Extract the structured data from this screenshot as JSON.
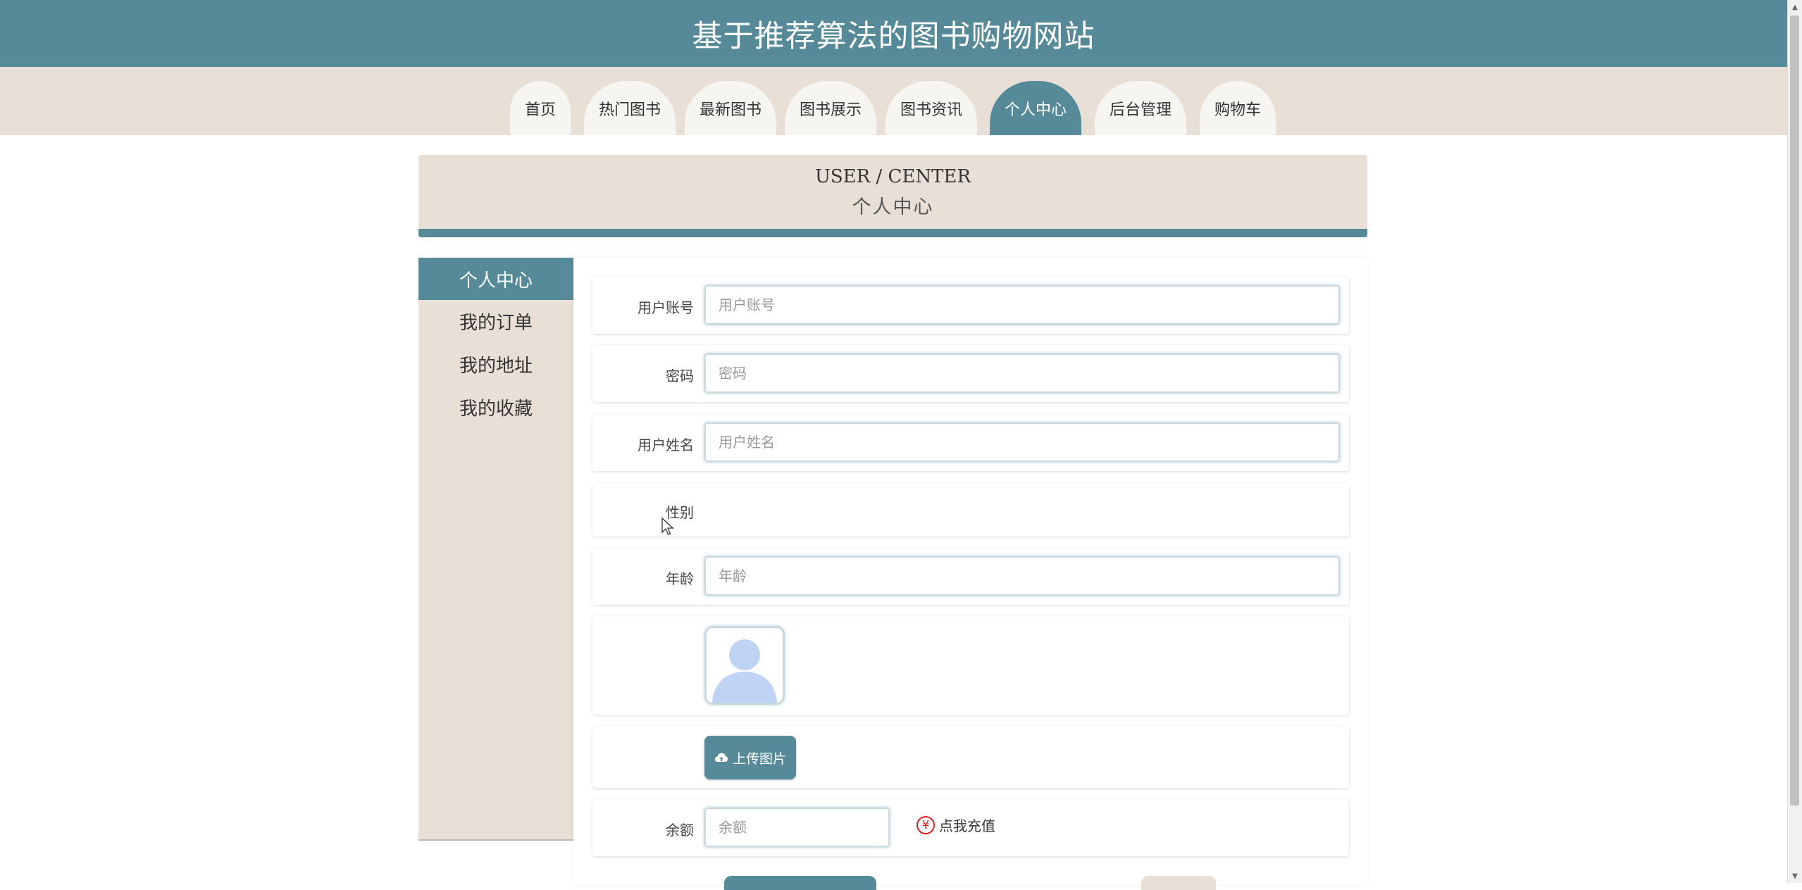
{
  "header": {
    "title": "基于推荐算法的图书购物网站"
  },
  "nav": {
    "tabs": [
      {
        "label": "首页"
      },
      {
        "label": "热门图书"
      },
      {
        "label": "最新图书"
      },
      {
        "label": "图书展示"
      },
      {
        "label": "图书资讯"
      },
      {
        "label": "个人中心",
        "active": true
      },
      {
        "label": "后台管理"
      },
      {
        "label": "购物车"
      }
    ]
  },
  "banner": {
    "en": "USER / CENTER",
    "cn": "个人中心"
  },
  "sidebar": {
    "items": [
      {
        "label": "个人中心",
        "active": true
      },
      {
        "label": "我的订单"
      },
      {
        "label": "我的地址"
      },
      {
        "label": "我的收藏"
      }
    ]
  },
  "form": {
    "username": {
      "label": "用户账号",
      "placeholder": "用户账号",
      "value": ""
    },
    "password": {
      "label": "密码",
      "placeholder": "密码",
      "value": ""
    },
    "realname": {
      "label": "用户姓名",
      "placeholder": "用户姓名",
      "value": ""
    },
    "gender": {
      "label": "性别"
    },
    "age": {
      "label": "年龄",
      "placeholder": "年龄",
      "value": ""
    },
    "avatar": {
      "icon": "user-avatar-placeholder"
    },
    "upload": {
      "label": "上传图片",
      "icon": "cloud-upload-icon"
    },
    "balance": {
      "label": "余额",
      "placeholder": "余额",
      "value": ""
    },
    "recharge": {
      "label": "点我充值",
      "icon": "yen-icon"
    }
  },
  "colors": {
    "primary": "#568a99",
    "beige": "#e8e0d6",
    "alert": "#e02020"
  }
}
